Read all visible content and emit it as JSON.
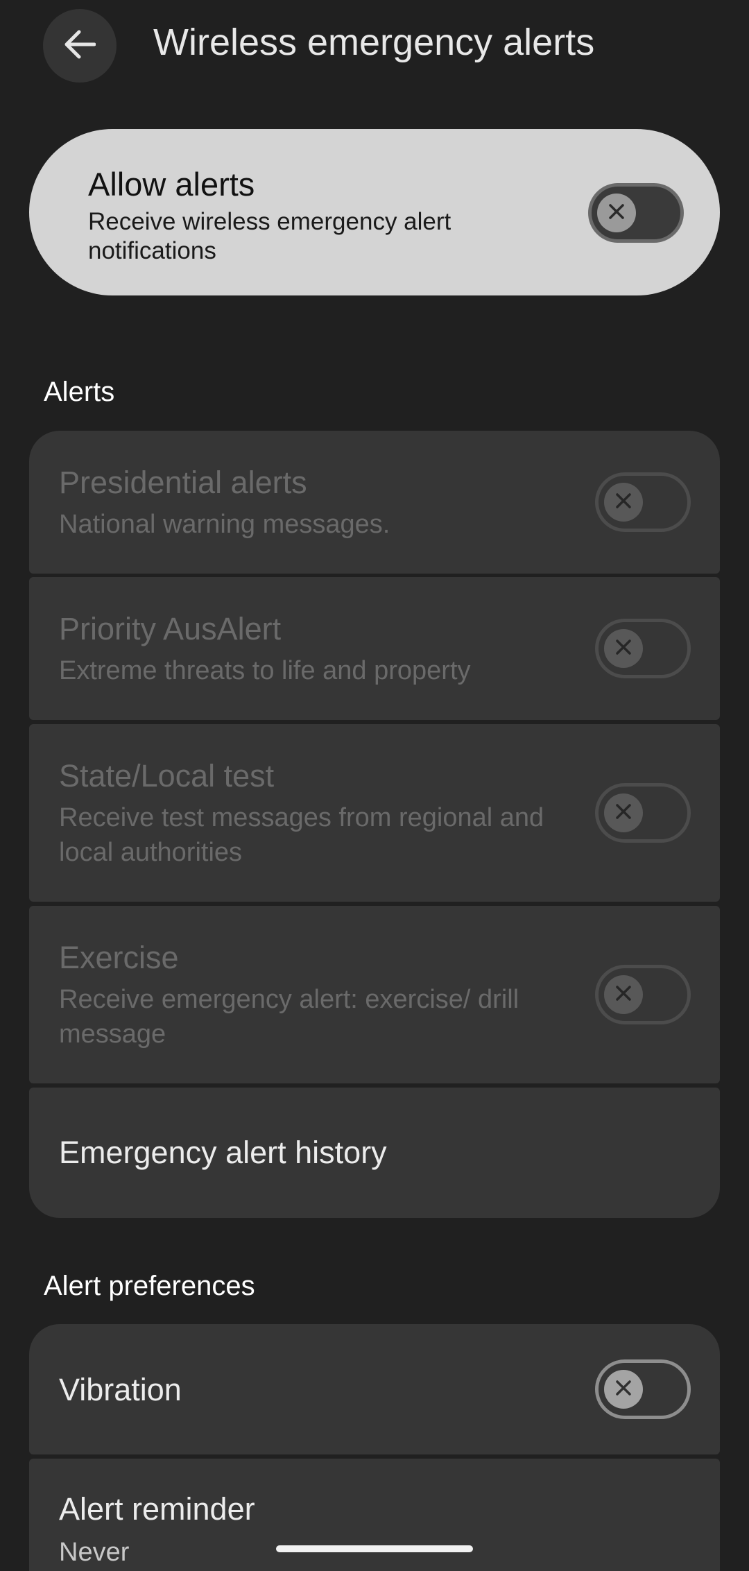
{
  "header": {
    "title": "Wireless emergency alerts",
    "back_icon": "arrow-left-icon"
  },
  "allow_alerts": {
    "title": "Allow alerts",
    "subtitle": "Receive wireless emergency alert notifications",
    "toggle_state": "off"
  },
  "sections": {
    "alerts_header": "Alerts",
    "preferences_header": "Alert preferences"
  },
  "alerts": [
    {
      "title": "Presidential alerts",
      "subtitle": "National warning messages.",
      "toggle_state": "off",
      "enabled": false
    },
    {
      "title": "Priority AusAlert",
      "subtitle": "Extreme threats to life and property",
      "toggle_state": "off",
      "enabled": false
    },
    {
      "title": "State/Local test",
      "subtitle": "Receive test messages from regional and local authorities",
      "toggle_state": "off",
      "enabled": false
    },
    {
      "title": "Exercise",
      "subtitle": "Receive emergency alert: exercise/ drill message",
      "toggle_state": "off",
      "enabled": false
    },
    {
      "title": "Emergency alert history"
    }
  ],
  "preferences": [
    {
      "title": "Vibration",
      "toggle_state": "off",
      "enabled": true
    },
    {
      "title": "Alert reminder",
      "subtitle": "Never"
    }
  ],
  "colors": {
    "background": "#202020",
    "card": "#363636",
    "main_card": "#d4d4d4"
  }
}
